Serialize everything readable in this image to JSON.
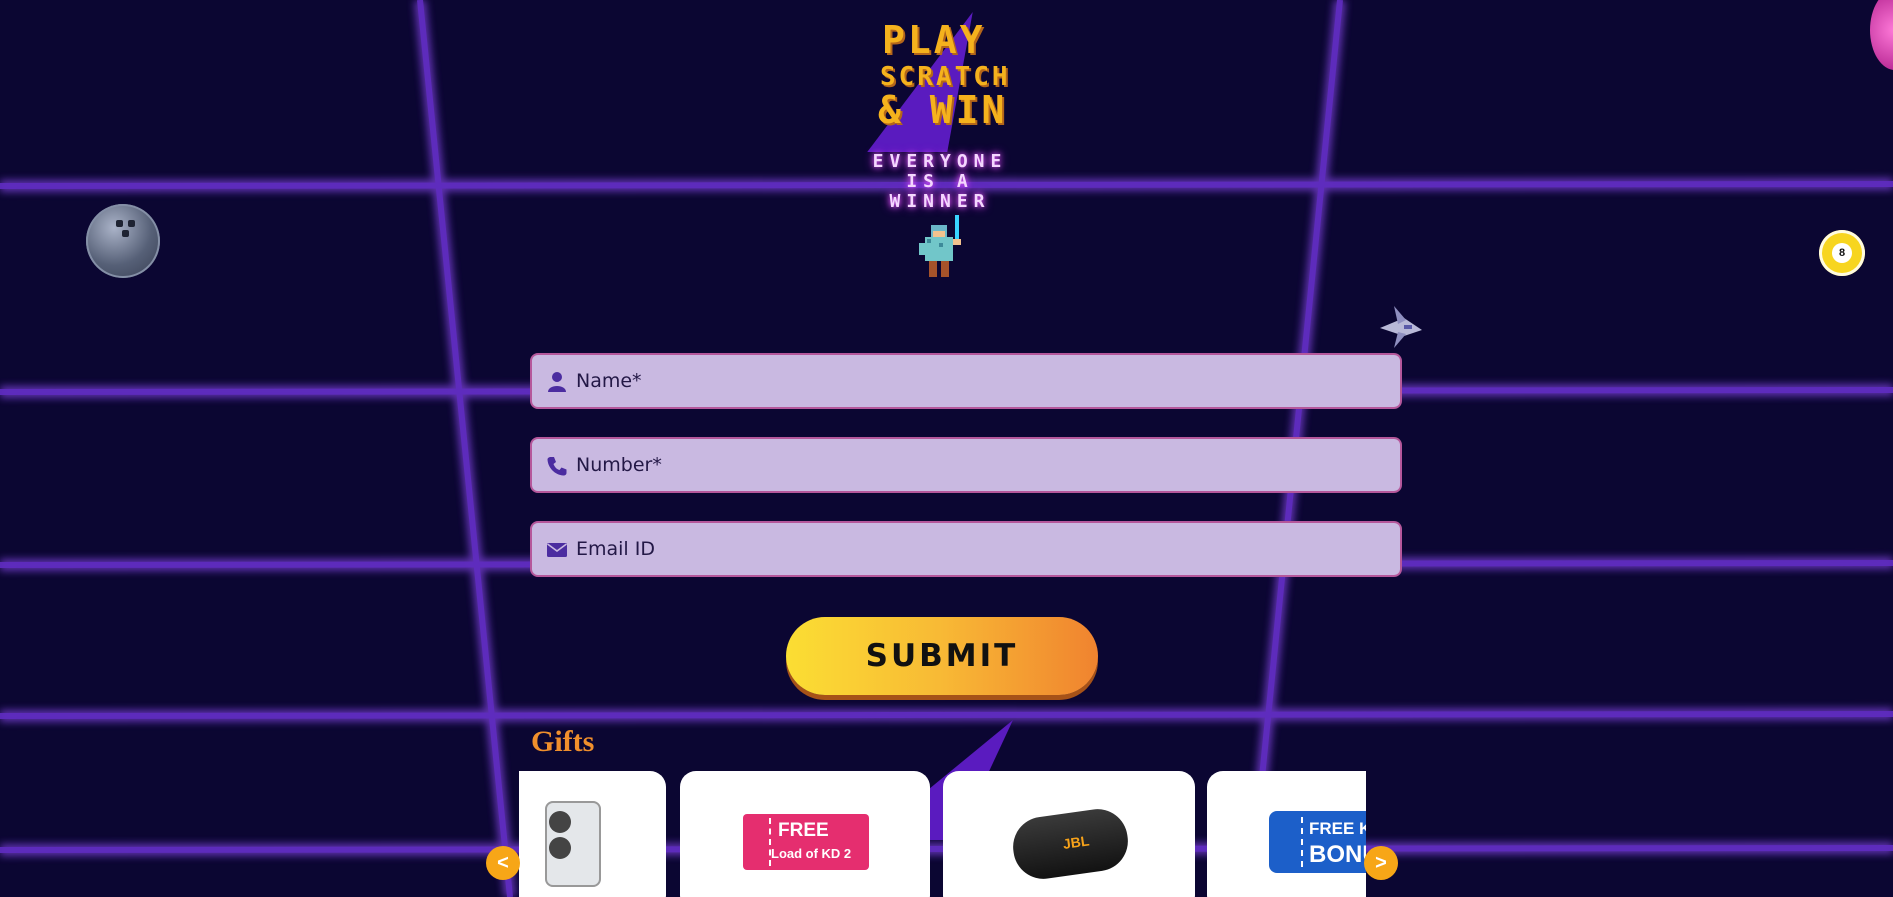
{
  "header": {
    "logo_lines": [
      "PLAY",
      "SCRATCH",
      "& WIN"
    ],
    "tagline_line1": "EVERYONE",
    "tagline_line2": "IS A WINNER"
  },
  "form": {
    "name_placeholder": "Name*",
    "number_placeholder": "Number*",
    "email_placeholder": "Email ID",
    "submit_label": "SUBMIT",
    "icons": {
      "name": "user-icon",
      "number": "phone-icon",
      "email": "envelope-icon"
    }
  },
  "gifts": {
    "title": "Gifts",
    "prev_label": "<",
    "next_label": ">",
    "items": [
      {
        "icon": "smartphone-image"
      },
      {
        "icon": "free-load-ticket-image",
        "text_1": "FREE",
        "text_2": "Load of KD 2"
      },
      {
        "icon": "speaker-image",
        "brand": "JBL"
      },
      {
        "icon": "bonus-ticket-image",
        "text_1": "FREE KD",
        "text_2": "BONUS"
      }
    ]
  },
  "colors": {
    "background": "#0b0632",
    "grid": "#6a35c8",
    "field_bg": "#c9b9e1",
    "accent_orange": "#f08f2c",
    "logo_yellow": "#f5b21d"
  }
}
